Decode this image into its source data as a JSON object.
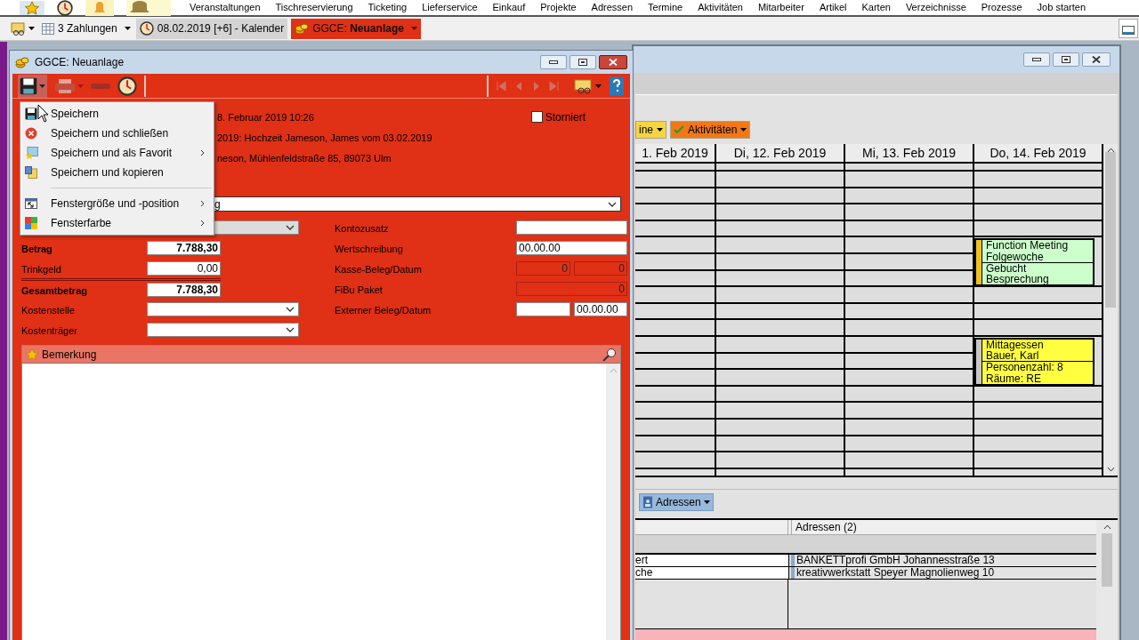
{
  "menu_bar": {
    "items": [
      "Veranstaltungen",
      "Tischreservierung",
      "Ticketing",
      "Lieferservice",
      "Einkauf",
      "Projekte",
      "Adressen",
      "Termine",
      "Aktivitäten",
      "Mitarbeiter",
      "Artikel",
      "Karten",
      "Verzeichnisse",
      "Prozesse",
      "Job starten"
    ]
  },
  "taskbar": {
    "items": [
      {
        "kind": "dropdown",
        "label": "3 Zahlungen",
        "selected": false
      },
      {
        "kind": "tab",
        "label": "08.02.2019 [+6] - Kalender",
        "selected": false
      },
      {
        "kind": "tab",
        "label": "GGCE: **Neuanlage**",
        "selected": true
      }
    ]
  },
  "form_window": {
    "title": "GGCE: Neuanlage",
    "info_lines": [
      "8. Februar 2019 10:26",
      "2019: Hochzeit Jameson, James vom 03.02.2019",
      "neson, Mühlenfeldstraße 85, 89073 Ulm"
    ],
    "storniert": {
      "label": "Storniert",
      "checked": false
    },
    "category_value": "g",
    "fields_left": [
      {
        "kind": "select",
        "disabled": true
      },
      {
        "kind": "amount",
        "label": "Betrag",
        "value": "7.788,30",
        "bold": true
      },
      {
        "kind": "amount",
        "label": "Trinkgeld",
        "value": "0,00",
        "bold": false
      },
      {
        "kind": "amount",
        "label": "Gesamtbetrag",
        "value": "7.788,30",
        "bold": true
      },
      {
        "kind": "select",
        "label": "Kostenstelle",
        "disabled": false
      },
      {
        "kind": "select",
        "label": "Kostenträger",
        "disabled": false
      }
    ],
    "fields_right": [
      {
        "kind": "text",
        "label": "Kontozusatz",
        "disabled": false
      },
      {
        "kind": "text",
        "label": "Wertschreibung",
        "value": "00.00.00",
        "disabled": false
      },
      {
        "kind": "pair",
        "label": "Kasse-Beleg/Datum",
        "first": "0",
        "second": "0",
        "disabled": true
      },
      {
        "kind": "text",
        "label": "FiBu Paket",
        "value": "0",
        "disabled": true
      },
      {
        "kind": "pair",
        "label": "Externer Beleg/Datum",
        "second": "00.00.00",
        "disabled": false
      }
    ],
    "remark_panel": {
      "title": "Bemerkung"
    }
  },
  "save_menu": {
    "items": [
      {
        "kind": "item",
        "label": "Speichern",
        "submenu": false
      },
      {
        "kind": "item",
        "label": "Speichern und schließen",
        "submenu": false
      },
      {
        "kind": "item",
        "label": "Speichern und als Favorit",
        "submenu": true
      },
      {
        "kind": "item",
        "label": "Speichern und kopieren",
        "submenu": false
      },
      {
        "kind": "separator"
      },
      {
        "kind": "item",
        "label": "Fenstergröße und -position",
        "submenu": true
      },
      {
        "kind": "item",
        "label": "Fensterfarbe",
        "submenu": true
      }
    ]
  },
  "calendar_window": {
    "toolbar": [
      {
        "label": "ine",
        "color": "#f5d642"
      },
      {
        "label": "Aktivitäten",
        "color": "#f07818"
      }
    ],
    "days": [
      {
        "header": "1. Feb 2019",
        "slots": [
          {
            "kind": "free"
          },
          {
            "kind": "free"
          },
          {
            "kind": "free"
          },
          {
            "kind": "free"
          },
          {
            "kind": "free"
          },
          {
            "kind": "free"
          },
          {
            "kind": "free"
          },
          {
            "kind": "free"
          },
          {
            "kind": "free"
          },
          {
            "kind": "free"
          },
          {
            "kind": "free"
          },
          {
            "kind": "free"
          },
          {
            "kind": "free"
          },
          {
            "kind": "free"
          },
          {
            "kind": "free"
          },
          {
            "kind": "free"
          },
          {
            "kind": "free"
          },
          {
            "kind": "free"
          }
        ]
      },
      {
        "header": "Di, 12. Feb 2019",
        "slots": [
          {
            "kind": "free"
          },
          {
            "kind": "free"
          },
          {
            "kind": "free"
          },
          {
            "kind": "free"
          },
          {
            "kind": "free"
          },
          {
            "kind": "free"
          },
          {
            "kind": "free"
          },
          {
            "kind": "free"
          },
          {
            "kind": "free"
          },
          {
            "kind": "free"
          },
          {
            "kind": "free"
          },
          {
            "kind": "free"
          },
          {
            "kind": "free"
          },
          {
            "kind": "free"
          },
          {
            "kind": "free"
          },
          {
            "kind": "free"
          },
          {
            "kind": "free"
          },
          {
            "kind": "free"
          }
        ]
      },
      {
        "header": "Mi, 13. Feb 2019",
        "slots": [
          {
            "kind": "free"
          },
          {
            "kind": "free"
          },
          {
            "kind": "free"
          },
          {
            "kind": "free"
          },
          {
            "kind": "free"
          },
          {
            "kind": "free"
          },
          {
            "kind": "free"
          },
          {
            "kind": "free"
          },
          {
            "kind": "free"
          },
          {
            "kind": "free"
          },
          {
            "kind": "free"
          },
          {
            "kind": "free"
          },
          {
            "kind": "free"
          },
          {
            "kind": "free"
          },
          {
            "kind": "free"
          },
          {
            "kind": "free"
          },
          {
            "kind": "free"
          },
          {
            "kind": "free"
          }
        ]
      },
      {
        "header": "Do, 14. Feb 2019",
        "slots": [
          {
            "kind": "free"
          },
          {
            "kind": "free"
          },
          {
            "kind": "free"
          },
          {
            "kind": "free"
          },
          {
            "kind": "event",
            "color": "#ccffcc",
            "status_bar": {
              "color": "#f0c020"
            },
            "parts": [
              [
                "Function Meeting",
                "Folgewoche"
              ],
              [
                "Gebucht",
                "Besprechung"
              ]
            ]
          },
          {
            "kind": "free"
          },
          {
            "kind": "free"
          },
          {
            "kind": "free"
          },
          {
            "kind": "event",
            "color": "#ffff40",
            "status_bar": {
              "color": "#c8c8c8"
            },
            "parts": [
              [
                "Mittagessen",
                "Bauer, Karl"
              ],
              [
                "Personenzahl: 8",
                "Räume: RE"
              ]
            ]
          },
          {
            "kind": "free"
          },
          {
            "kind": "free"
          },
          {
            "kind": "free"
          },
          {
            "kind": "free"
          },
          {
            "kind": "free"
          }
        ]
      }
    ],
    "address_button": "Adressen",
    "address_table": {
      "column_2_header": "Adressen (2)",
      "rows": [
        [
          "ert",
          "BANKETTprofi GmbH Johannesstraße 13"
        ],
        [
          "che",
          "kreativwerkstatt Speyer Magnolienweg 10"
        ]
      ]
    }
  }
}
